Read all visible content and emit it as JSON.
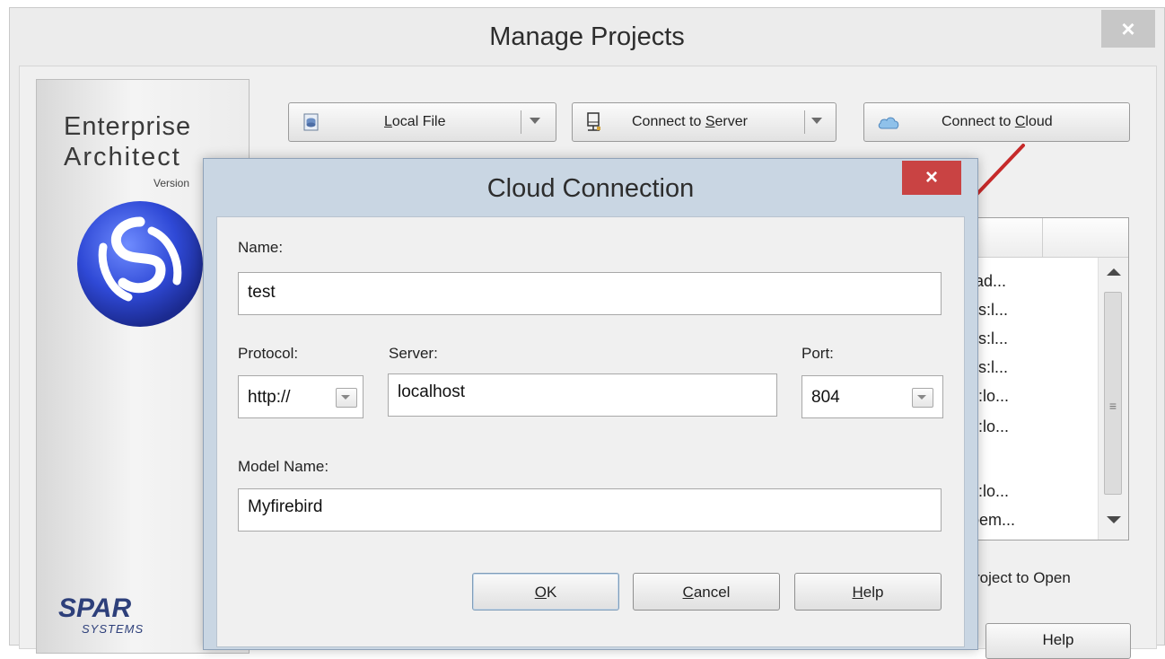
{
  "outer_window": {
    "title": "Manage Projects",
    "close_glyph": "×"
  },
  "branding": {
    "line1": "Enterprise",
    "line2": "Architect",
    "version": "Version",
    "company": "SPAR",
    "company_sub": "SYSTEMS"
  },
  "toolbar": {
    "local_file": {
      "label_underlined": "L",
      "label_rest": "ocal File",
      "icon": "database-file-icon"
    },
    "connect_server": {
      "label_pre": "Connect to ",
      "label_underlined": "S",
      "label_rest": "erver",
      "icon": "server-icon"
    },
    "connect_cloud": {
      "label_pre": "Connect to ",
      "label_underlined": "C",
      "label_rest": "loud",
      "icon": "cloud-icon"
    }
  },
  "recent_list": {
    "items": [
      ",ad...",
      "ss:l...",
      "ss:l...",
      "ss:l...",
      "s:lo...",
      "s:lo...",
      "s:lo...",
      "oem..."
    ]
  },
  "project_to_open": "roject to Open",
  "outer_help_label": "Help",
  "dialog": {
    "title": "Cloud Connection",
    "close_glyph": "×",
    "name_label": "Name:",
    "name_value": "test",
    "protocol_label": "Protocol:",
    "protocol_value": "http://",
    "server_label": "Server:",
    "server_value": "localhost",
    "port_label": "Port:",
    "port_value": "804",
    "model_label": "Model Name:",
    "model_value": "Myfirebird",
    "ok_u": "O",
    "ok_rest": "K",
    "cancel_u": "C",
    "cancel_rest": "ancel",
    "help_u": "H",
    "help_rest": "elp"
  },
  "colors": {
    "dialog_frame": "#c9d6e3",
    "close_red": "#c94343",
    "annotation_arrow": "#c62a2a"
  }
}
